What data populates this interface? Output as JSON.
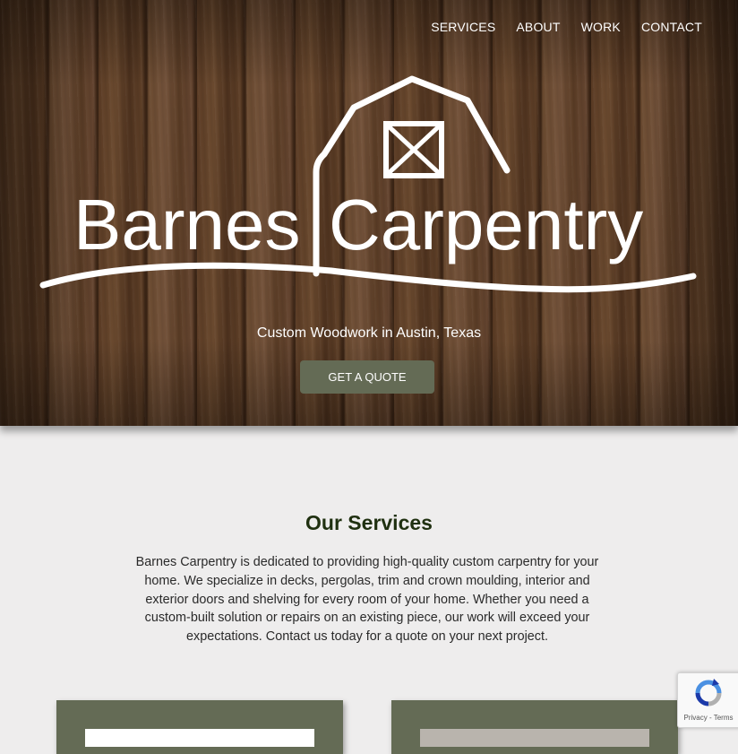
{
  "nav": {
    "items": [
      {
        "label": "SERVICES"
      },
      {
        "label": "ABOUT"
      },
      {
        "label": "WORK"
      },
      {
        "label": "CONTACT"
      }
    ]
  },
  "hero": {
    "logo_text_left": "Barnes",
    "logo_text_right": "Carpentry",
    "tagline": "Custom Woodwork in Austin, Texas",
    "cta_label": "GET A QUOTE"
  },
  "services": {
    "title": "Our Services",
    "description": "Barnes Carpentry is dedicated to providing high-quality custom carpentry for your home. We specialize in decks, pergolas, trim and crown moulding, interior and exterior doors and shelving for every room of your home. Whether you need a custom-built solution or repairs on an existing piece, our work will exceed your expectations. Contact us today for a quote on your next project."
  },
  "recaptcha": {
    "terms": "Privacy - Terms"
  },
  "colors": {
    "accent": "#646b55",
    "heading": "#1f3010",
    "background": "#eeeded"
  }
}
